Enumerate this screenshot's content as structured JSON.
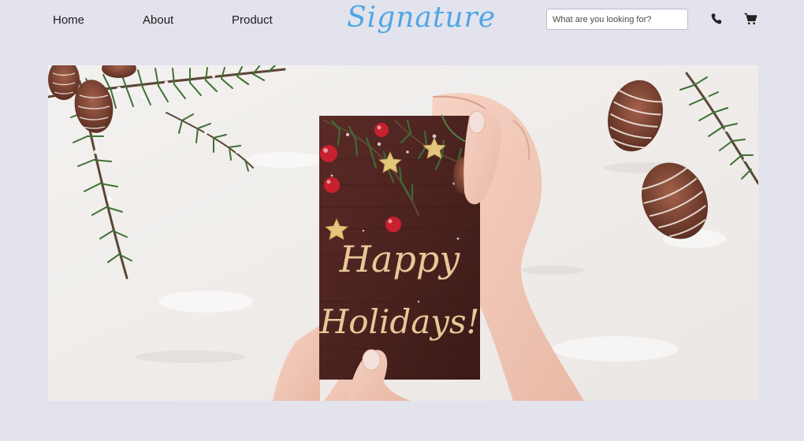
{
  "nav": {
    "items": [
      {
        "label": "Home"
      },
      {
        "label": "About"
      },
      {
        "label": "Product"
      }
    ]
  },
  "brand": {
    "logo_text": "Signature",
    "color": "#4fa6e6"
  },
  "search": {
    "placeholder": "What are you looking for?"
  },
  "icons": {
    "phone": "phone-icon",
    "cart": "cart-icon"
  },
  "hero": {
    "card_line1": "Happy",
    "card_line2": "Holidays!",
    "colors": {
      "background": "#f1eeec",
      "card": "#4b2420",
      "lettering": "#e8c899",
      "berry": "#c8202e",
      "needle": "#3d6b34"
    }
  }
}
